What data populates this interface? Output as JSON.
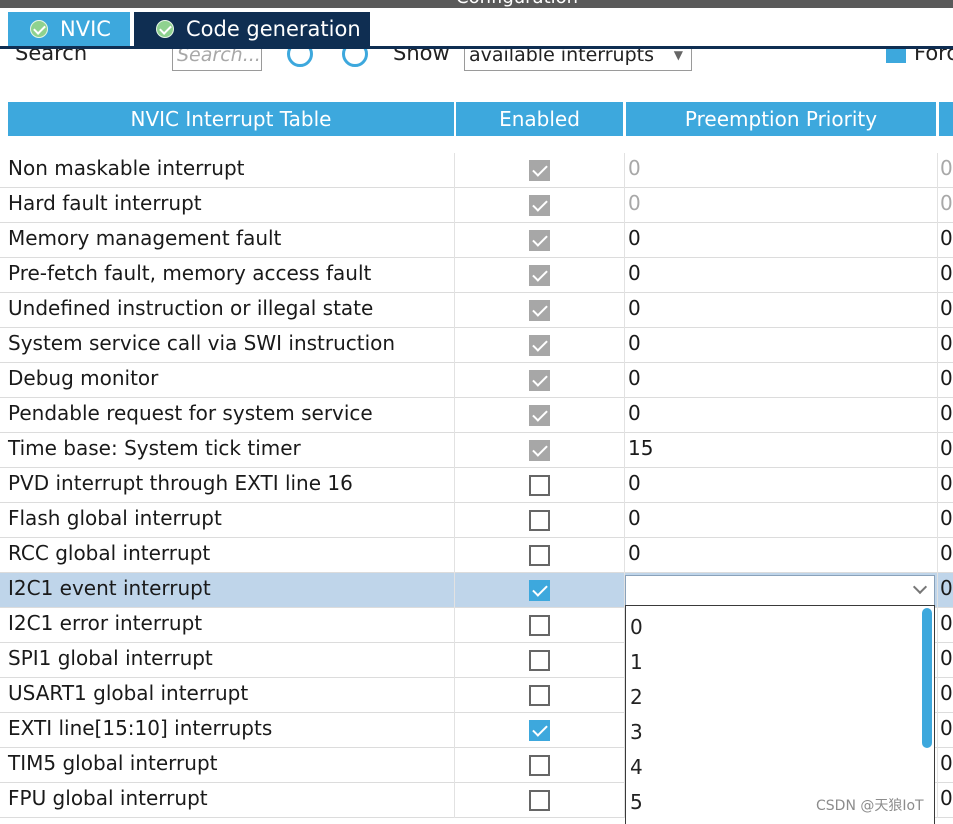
{
  "window": {
    "title": "Configuration"
  },
  "tabs": [
    {
      "label": "NVIC",
      "active": true
    },
    {
      "label": "Code generation",
      "active": false
    }
  ],
  "filter": {
    "search_label": "Search",
    "search_placeholder": "Search...",
    "show_label": "Show",
    "show_value": "available interrupts",
    "force_label": "Force"
  },
  "table": {
    "headers": [
      "NVIC Interrupt Table",
      "Enabled",
      "Preemption Priority"
    ],
    "rows": [
      {
        "name": "Non maskable interrupt",
        "enabled": true,
        "locked": true,
        "priority": "0",
        "sub": "0"
      },
      {
        "name": "Hard fault interrupt",
        "enabled": true,
        "locked": true,
        "priority": "0",
        "sub": "0"
      },
      {
        "name": "Memory management fault",
        "enabled": true,
        "locked": true,
        "priority": "0",
        "sub": "0"
      },
      {
        "name": "Pre-fetch fault, memory access fault",
        "enabled": true,
        "locked": true,
        "priority": "0",
        "sub": "0"
      },
      {
        "name": "Undefined instruction or illegal state",
        "enabled": true,
        "locked": true,
        "priority": "0",
        "sub": "0"
      },
      {
        "name": "System service call via SWI instruction",
        "enabled": true,
        "locked": true,
        "priority": "0",
        "sub": "0"
      },
      {
        "name": "Debug monitor",
        "enabled": true,
        "locked": true,
        "priority": "0",
        "sub": "0"
      },
      {
        "name": "Pendable request for system service",
        "enabled": true,
        "locked": true,
        "priority": "0",
        "sub": "0"
      },
      {
        "name": "Time base: System tick timer",
        "enabled": true,
        "locked": true,
        "priority": "15",
        "sub": "0"
      },
      {
        "name": "PVD interrupt through EXTI line 16",
        "enabled": false,
        "locked": false,
        "priority": "0",
        "sub": "0"
      },
      {
        "name": "Flash global interrupt",
        "enabled": false,
        "locked": false,
        "priority": "0",
        "sub": "0"
      },
      {
        "name": "RCC global interrupt",
        "enabled": false,
        "locked": false,
        "priority": "0",
        "sub": "0"
      },
      {
        "name": "I2C1 event interrupt",
        "enabled": true,
        "locked": false,
        "priority": "",
        "sub": "0",
        "selected": true
      },
      {
        "name": "I2C1 error interrupt",
        "enabled": false,
        "locked": false,
        "priority": "",
        "sub": "0"
      },
      {
        "name": "SPI1 global interrupt",
        "enabled": false,
        "locked": false,
        "priority": "",
        "sub": "0"
      },
      {
        "name": "USART1 global interrupt",
        "enabled": false,
        "locked": false,
        "priority": "",
        "sub": "0"
      },
      {
        "name": "EXTI line[15:10] interrupts",
        "enabled": true,
        "locked": false,
        "priority": "",
        "sub": "0"
      },
      {
        "name": "TIM5 global interrupt",
        "enabled": false,
        "locked": false,
        "priority": "",
        "sub": "0"
      },
      {
        "name": "FPU global interrupt",
        "enabled": false,
        "locked": false,
        "priority": "",
        "sub": "0"
      }
    ]
  },
  "priority_dropdown": {
    "options": [
      "0",
      "1",
      "2",
      "3",
      "4",
      "5"
    ]
  },
  "watermark": "CSDN @天狼IoT",
  "colors": {
    "accent": "#3da8dd",
    "tab_dark": "#0f2e52",
    "selected_row": "#bfd5ea"
  },
  "icons": {
    "tab_status": "check-circle-icon",
    "nav_prev": "arrow-left-circle-icon",
    "nav_next": "arrow-right-circle-icon"
  }
}
